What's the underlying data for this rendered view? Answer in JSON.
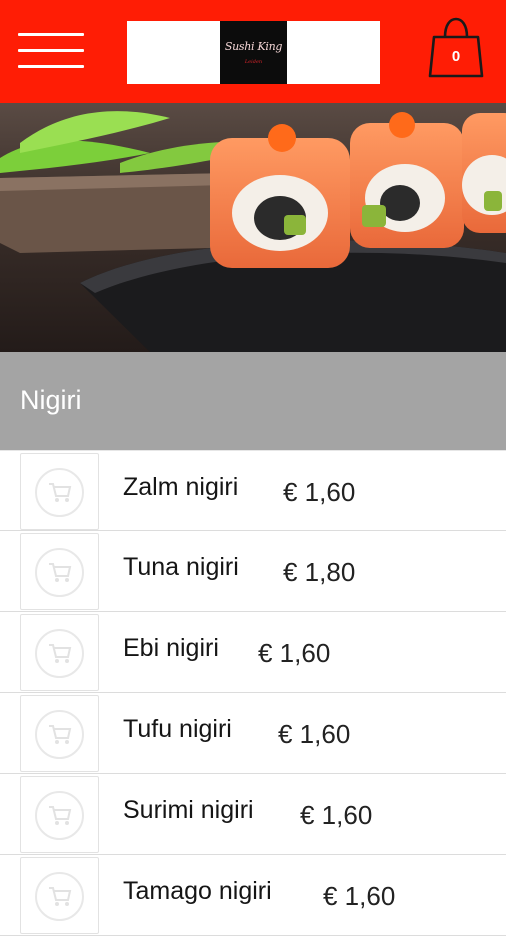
{
  "header": {
    "menu_icon": "hamburger-menu-icon",
    "logo_text": "Sushi King",
    "logo_subtext": "Leiden",
    "cart_icon": "shopping-bag-icon",
    "cart_count": "0",
    "brand_color": "#ff1d05"
  },
  "hero": {
    "image_subject": "salmon sushi rolls on slate"
  },
  "section": {
    "title": "Nigiri",
    "background": "#a4a4a4"
  },
  "items": [
    {
      "name": "Zalm nigiri",
      "price": "€ 1,60",
      "icon": "cart-icon"
    },
    {
      "name": "Tuna nigiri",
      "price": "€ 1,80",
      "icon": "cart-icon"
    },
    {
      "name": "Ebi nigiri",
      "price": "€ 1,60",
      "icon": "cart-icon"
    },
    {
      "name": "Tufu nigiri",
      "price": "€ 1,60",
      "icon": "cart-icon"
    },
    {
      "name": "Surimi nigiri",
      "price": "€ 1,60",
      "icon": "cart-icon"
    },
    {
      "name": "Tamago nigiri",
      "price": "€ 1,60",
      "icon": "cart-icon"
    }
  ]
}
